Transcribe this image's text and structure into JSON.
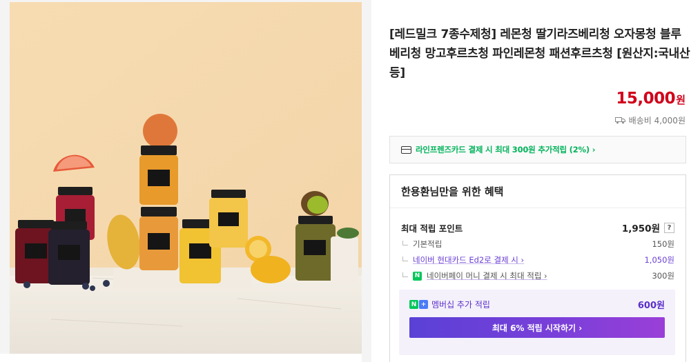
{
  "product": {
    "title": "[레드밀크 7종수제청] 레몬청 딸기라즈베리청 오자몽청 블루베리청 망고후르츠청 파인레몬청 패션후르츠청 [원산지:국내산 등]",
    "price": "15,000",
    "currency": "원",
    "shipping": "배송비 4,000원",
    "image_icon": "product-photo"
  },
  "card_promo": {
    "text": "라인프렌즈카드 결제 시 최대 300원 추가적립 (2%) ›"
  },
  "benefit": {
    "heading": "한용환님만을 위한 혜택",
    "max_points_label": "최대 적립 포인트",
    "max_points_value": "1,950원",
    "help": "?",
    "rows": [
      {
        "label": "기본적립",
        "value": "150원"
      },
      {
        "label": "네이버 현대카드 Ed2로 결제 시 ›",
        "value": "1,050원"
      },
      {
        "label": "네이버페이 머니 결제 시 최대 적립 ›",
        "value": "300원"
      }
    ],
    "npay_badge": "N",
    "membership_label": "멤버십 추가 적립",
    "membership_value": "600원",
    "membership_badge_1": "N",
    "membership_badge_2": "+",
    "cta": "최대 6% 적립 시작하기 ›"
  },
  "colors": {
    "price": "#d0021b",
    "card_promo": "#00b35a",
    "accent_purple": "#6b3fd4"
  }
}
